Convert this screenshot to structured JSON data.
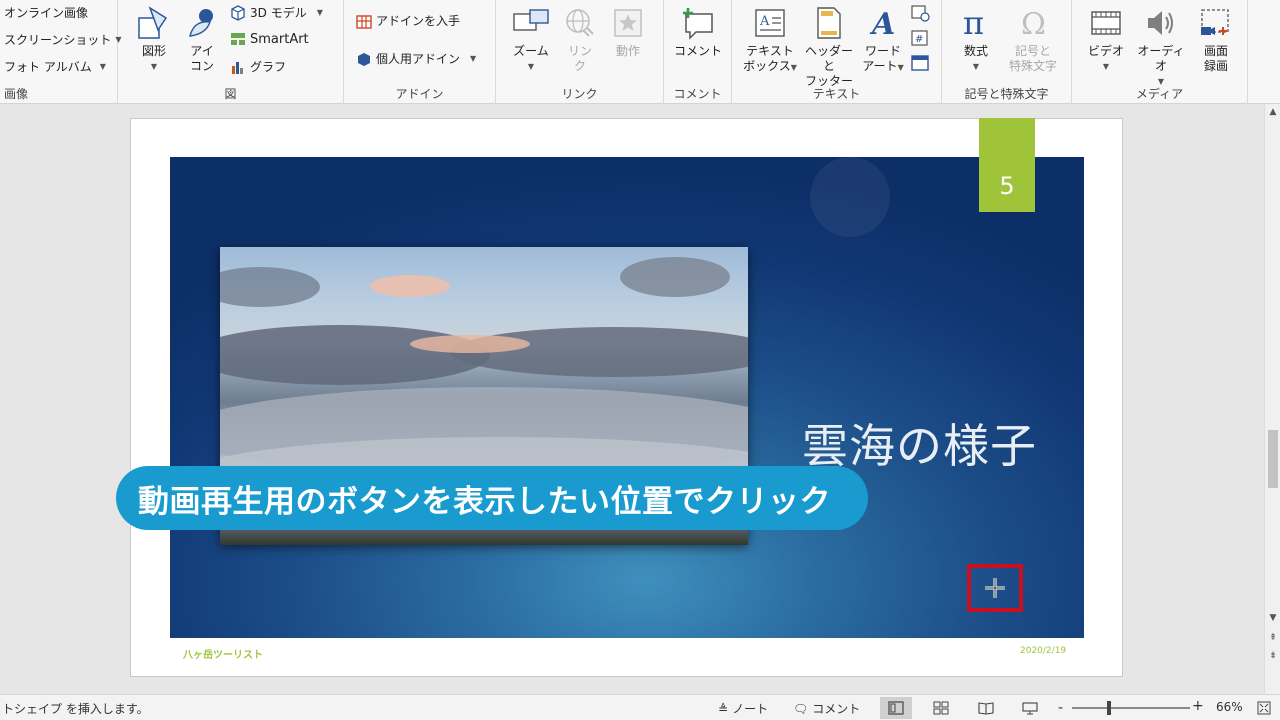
{
  "ribbon": {
    "images_group": {
      "online_images": "オンライン画像",
      "screenshot": "スクリーンショット",
      "photo_album": "フォト アルバム",
      "label": "画像"
    },
    "illustrations_group": {
      "shapes": "図形",
      "icons_line1": "アイ",
      "icons_line2": "コン",
      "models_3d": "3D モデル",
      "smartart": "SmartArt",
      "chart": "グラフ",
      "label": "図"
    },
    "addins_group": {
      "get_addins": "アドインを入手",
      "my_addins": "個人用アドイン",
      "label": "アドイン"
    },
    "links_group": {
      "zoom": "ズーム",
      "link_line1": "リン",
      "link_line2": "ク",
      "action": "動作",
      "label": "リンク"
    },
    "comments_group": {
      "comment": "コメント",
      "label": "コメント"
    },
    "text_group": {
      "textbox_line1": "テキスト",
      "textbox_line2": "ボックス",
      "headerfooter_line1": "ヘッダーと",
      "headerfooter_line2": "フッター",
      "wordart_line1": "ワード",
      "wordart_line2": "アート",
      "label": "テキスト"
    },
    "symbols_group": {
      "equation": "数式",
      "symbol_line1": "記号と",
      "symbol_line2": "特殊文字",
      "label": "記号と特殊文字"
    },
    "media_group": {
      "video": "ビデオ",
      "audio": "オーディオ",
      "screen_rec_line1": "画面",
      "screen_rec_line2": "録画",
      "label": "メディア"
    }
  },
  "slide": {
    "number": "5",
    "title": "雲海の様子",
    "footer_left": "八ヶ岳ツーリスト",
    "footer_right": "2020/2/19"
  },
  "callout": {
    "text": "動画再生用のボタンを表示したい位置でクリック"
  },
  "status": {
    "message": "トシェイプ を挿入します。",
    "notes": "ノート",
    "comments": "コメント",
    "zoom_minus": "-",
    "zoom_plus": "+",
    "zoom_level": "66%"
  },
  "colors": {
    "accent_green": "#9fc43a",
    "callout_blue": "#1a9bd0",
    "highlight_red": "#c8101e",
    "slide_dark": "#113874"
  }
}
